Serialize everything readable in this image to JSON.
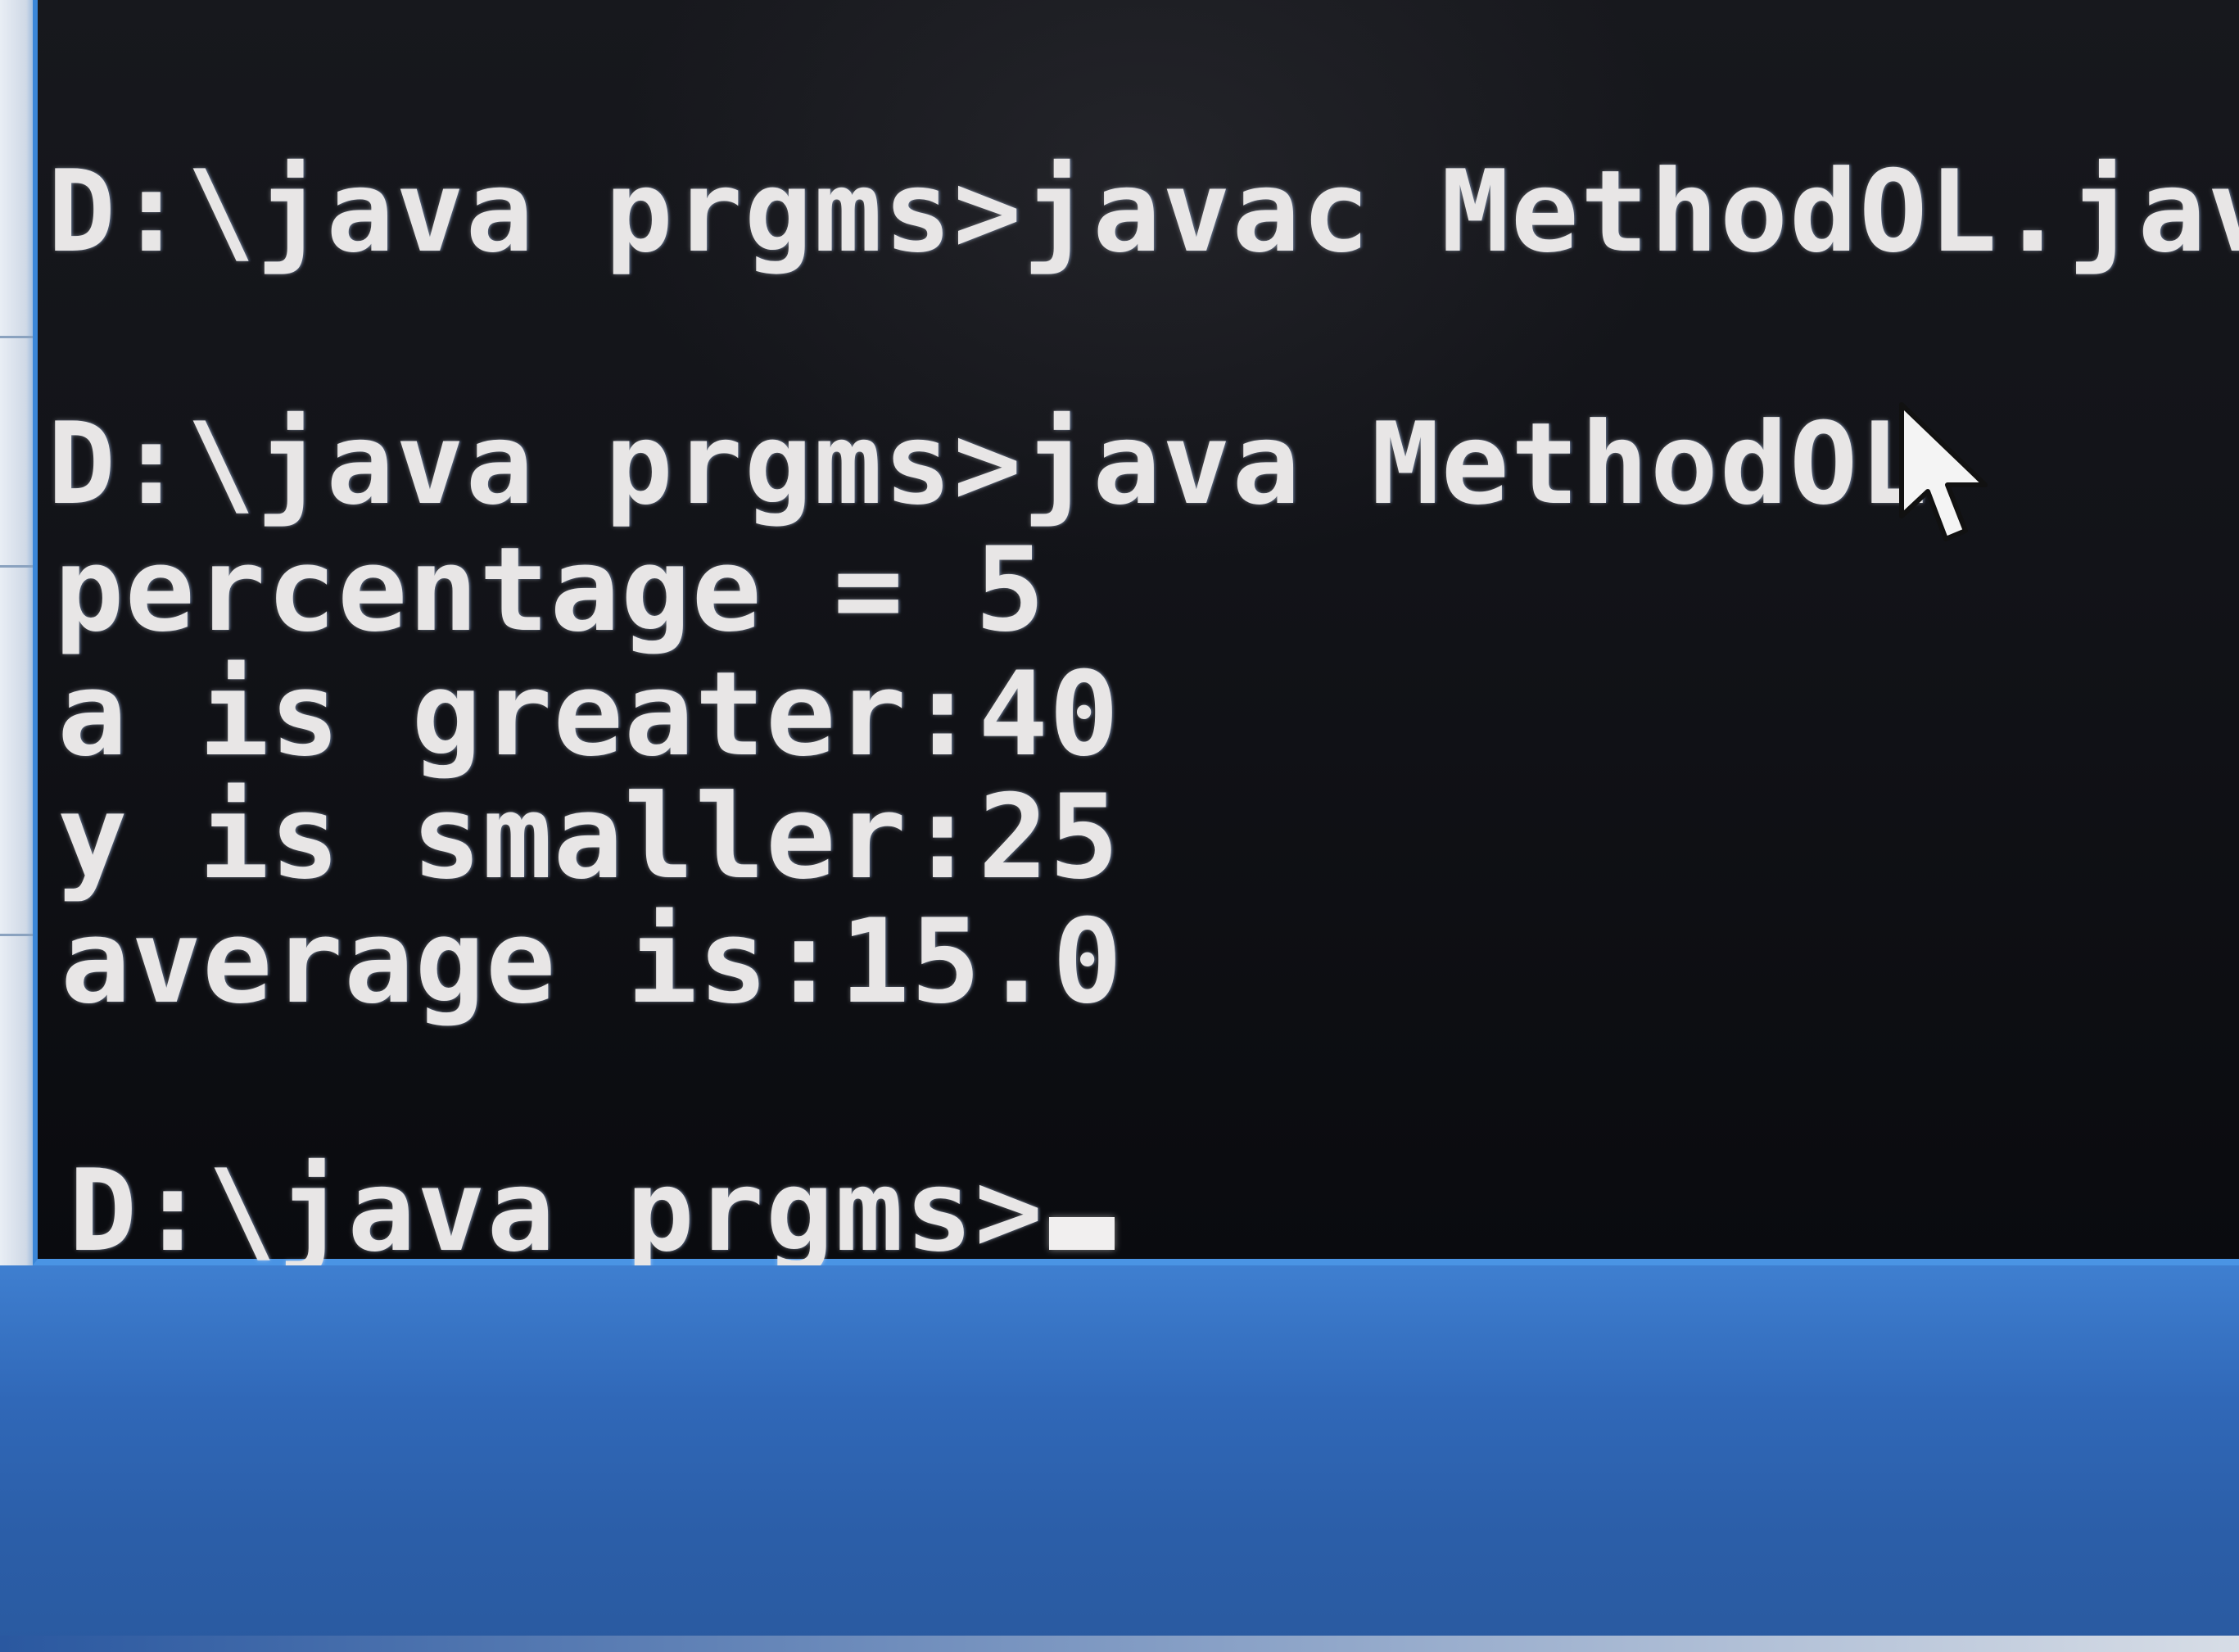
{
  "window": {
    "type": "command-prompt",
    "background_color": "#121318",
    "text_color": "#e8e6e6",
    "border_color": "#3a86d8"
  },
  "terminal": {
    "lines": [
      "D:\\java prgms>javac MethodOL.java",
      "D:\\java prgms>java MethodOL",
      "percentage = 5",
      "a is greater:40",
      "y is smaller:25",
      "average is:15.0",
      "D:\\java prgms>"
    ]
  },
  "cursor": {
    "icon": "arrow-pointer-icon",
    "caret": "block-caret"
  },
  "taskbar": {
    "color": "#3068b8"
  }
}
